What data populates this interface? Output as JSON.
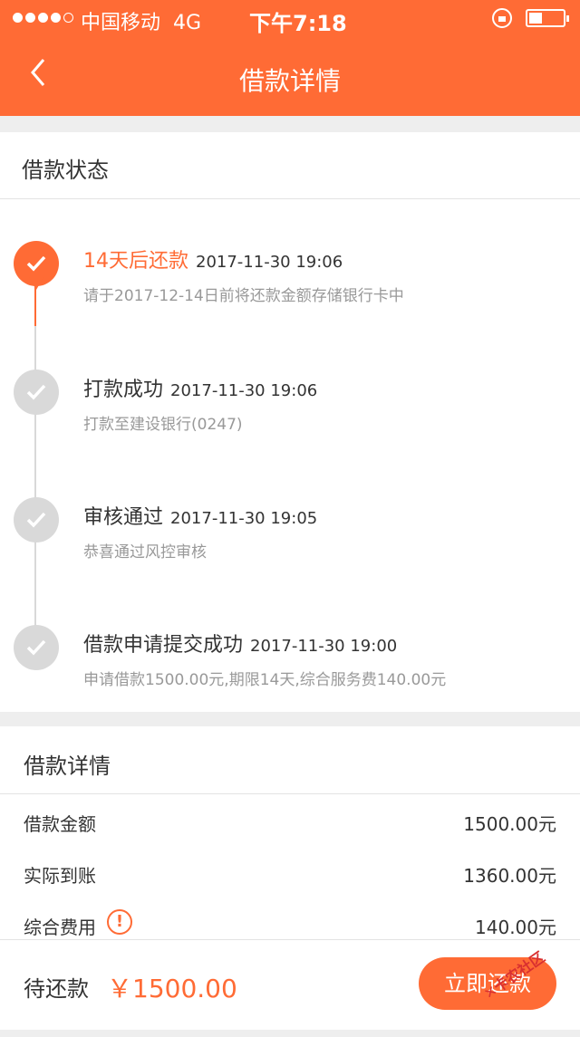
{
  "status_bar": {
    "carrier": "中国移动",
    "network": "4G",
    "time": "下午7:18"
  },
  "nav": {
    "title": "借款详情",
    "back_icon": "chevron-left-icon"
  },
  "status_section": {
    "title": "借款状态",
    "steps": [
      {
        "name": "14天后还款",
        "date": "2017-11-30 19:06",
        "desc": "请于2017-12-14日前将还款金额存储银行卡中",
        "active": true
      },
      {
        "name": "打款成功",
        "date": "2017-11-30 19:06",
        "desc": "打款至建设银行(0247)",
        "active": false
      },
      {
        "name": "审核通过",
        "date": "2017-11-30 19:05",
        "desc": "恭喜通过风控审核",
        "active": false
      },
      {
        "name": "借款申请提交成功",
        "date": "2017-11-30 19:00",
        "desc": "申请借款1500.00元,期限14天,综合服务费140.00元",
        "active": false
      }
    ]
  },
  "detail_section": {
    "title": "借款详情",
    "rows": [
      {
        "label": "借款金额",
        "value": "1500.00元"
      },
      {
        "label": "实际到账",
        "value": "1360.00元"
      },
      {
        "label": "综合费用",
        "value": "140.00元"
      }
    ],
    "info_icon": "!"
  },
  "footer": {
    "due_label": "待还款",
    "due_amount": "￥1500.00",
    "repay_button": "立即还款"
  },
  "watermark": "卡农社区",
  "colors": {
    "accent": "#ff6b35",
    "inactive_node": "#d9d9d9"
  }
}
